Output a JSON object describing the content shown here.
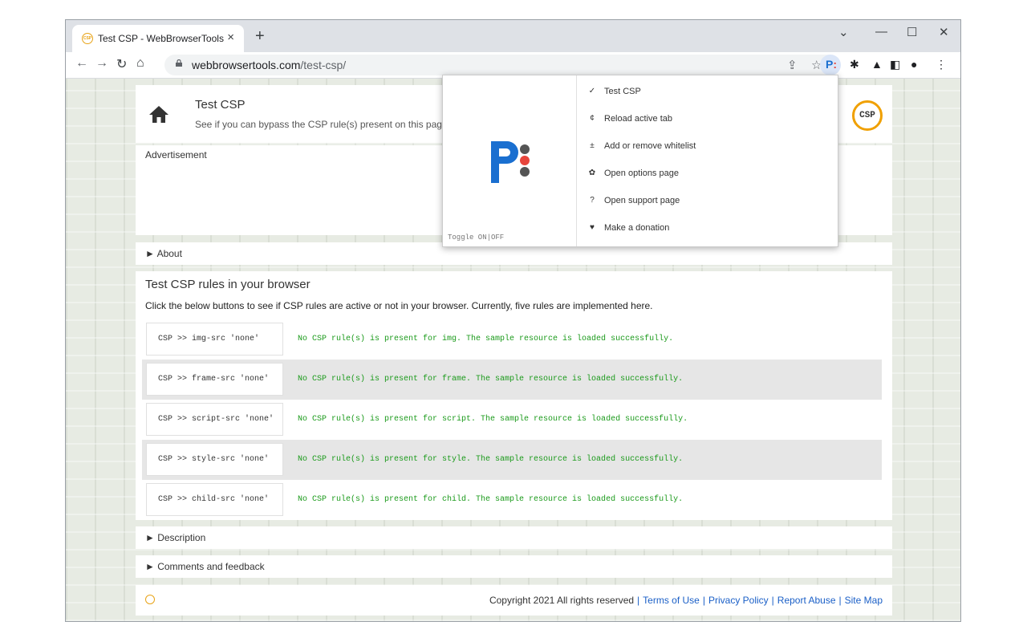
{
  "browser": {
    "tab_title": "Test CSP - WebBrowserTools",
    "tab_close": "×",
    "new_tab": "+",
    "url_host": "webbrowsertools.com",
    "url_path": "/test-csp/",
    "favicon_text": "CSP"
  },
  "header": {
    "title": "Test CSP",
    "subtitle": "See if you can bypass the CSP rule(s) present on this page",
    "logo_text": "CSP"
  },
  "ad": {
    "label": "Advertisement"
  },
  "about": {
    "label": "About"
  },
  "test": {
    "title": "Test CSP rules in your browser",
    "description": "Click the below buttons to see if CSP rules are active or not in your browser. Currently, five rules are implemented here.",
    "rows": [
      {
        "button": "CSP >> img-src 'none'",
        "result": "No CSP rule(s) is present for img. The sample resource is loaded successfully."
      },
      {
        "button": "CSP >> frame-src 'none'",
        "result": "No CSP rule(s) is present for frame. The sample resource is loaded successfully."
      },
      {
        "button": "CSP >> script-src 'none'",
        "result": "No CSP rule(s) is present for script. The sample resource is loaded successfully."
      },
      {
        "button": "CSP >> style-src 'none'",
        "result": "No CSP rule(s) is present for style. The sample resource is loaded successfully."
      },
      {
        "button": "CSP >> child-src 'none'",
        "result": "No CSP rule(s) is present for child. The sample resource is loaded successfully."
      }
    ]
  },
  "description": {
    "label": "Description"
  },
  "comments": {
    "label": "Comments and feedback"
  },
  "footer": {
    "copyright": "Copyright 2021 All rights reserved",
    "terms": "Terms of Use",
    "privacy": "Privacy Policy",
    "abuse": "Report Abuse",
    "sitemap": "Site Map"
  },
  "popup": {
    "toggle": "Toggle ON|OFF",
    "menu": [
      {
        "icon": "✓",
        "label": "Test CSP"
      },
      {
        "icon": "¢",
        "label": "Reload active tab"
      },
      {
        "icon": "±",
        "label": "Add or remove whitelist"
      },
      {
        "icon": "✿",
        "label": "Open options page"
      },
      {
        "icon": "?",
        "label": "Open support page"
      },
      {
        "icon": "♥",
        "label": "Make a donation"
      }
    ]
  },
  "colors": {
    "accent_orange": "#f0a000",
    "result_green": "#1a9a1a",
    "link_blue": "#1a5fc7",
    "logo_blue": "#1a6fd0",
    "logo_red": "#e8453c"
  }
}
